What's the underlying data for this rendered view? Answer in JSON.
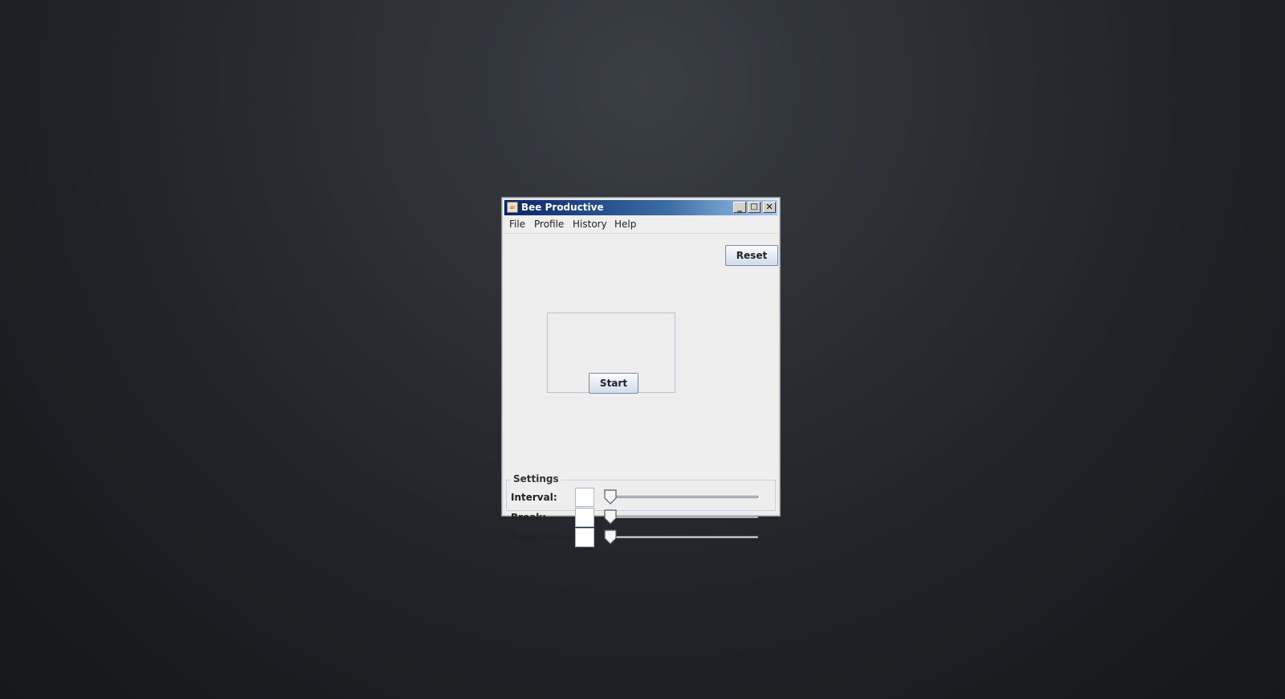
{
  "window": {
    "title": "Bee Productive",
    "controls": {
      "minimize": "_",
      "maximize": "□",
      "close": "✕"
    }
  },
  "menu": [
    "File",
    "Profile",
    "History",
    "Help"
  ],
  "buttons": {
    "reset": "Reset",
    "start": "Start"
  },
  "settings": {
    "legend": "Settings",
    "rows": [
      {
        "label": "Interval:",
        "value": "",
        "slider": 0
      },
      {
        "label": "Break:",
        "value": "",
        "slider": 0
      },
      {
        "label": "Repetitions:",
        "value": "",
        "slider": 0
      }
    ]
  },
  "icons": {
    "app": "java-icon"
  }
}
